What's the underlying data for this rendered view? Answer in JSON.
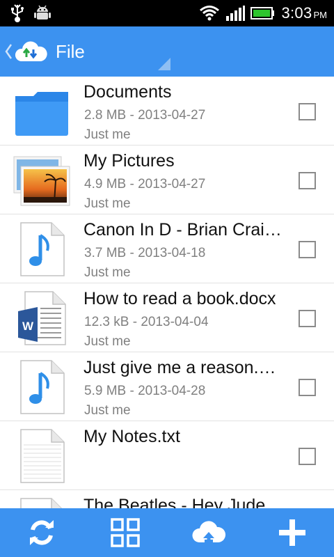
{
  "status_bar": {
    "time": "3:03",
    "ampm": "PM",
    "icons": [
      "usb-icon",
      "android-debug-icon",
      "wifi-icon",
      "signal-icon",
      "battery-icon"
    ]
  },
  "app_bar": {
    "title": "File",
    "icons": [
      "back-chevron-icon",
      "cloud-sync-logo-icon",
      "dropdown-triangle-icon"
    ]
  },
  "files": [
    {
      "name": "Documents",
      "meta": "2.8 MB - 2013-04-27",
      "owner": "Just me",
      "icon": "folder-icon"
    },
    {
      "name": "My Pictures",
      "meta": "4.9 MB - 2013-04-27",
      "owner": "Just me",
      "icon": "pictures-folder-icon"
    },
    {
      "name": "Canon In D - Brian Crai…",
      "meta": "3.7 MB - 2013-04-18",
      "owner": "Just me",
      "icon": "music-file-icon"
    },
    {
      "name": "How to read a book.docx",
      "meta": "12.3 kB - 2013-04-04",
      "owner": "Just me",
      "icon": "word-document-icon"
    },
    {
      "name": "Just give me a reason.…",
      "meta": "5.9 MB - 2013-04-28",
      "owner": "Just me",
      "icon": "music-file-icon"
    },
    {
      "name": "My Notes.txt",
      "meta": "",
      "owner": "",
      "icon": "text-file-icon"
    },
    {
      "name": "The Beatles - Hey Jude",
      "meta": "",
      "owner": "",
      "icon": "music-file-icon"
    }
  ],
  "bottom_bar": {
    "buttons": [
      "refresh-icon",
      "grid-view-icon",
      "upload-icon",
      "add-icon"
    ]
  },
  "colors": {
    "accent": "#3c92f0",
    "status_bar": "#000000",
    "meta_text": "#808080"
  }
}
